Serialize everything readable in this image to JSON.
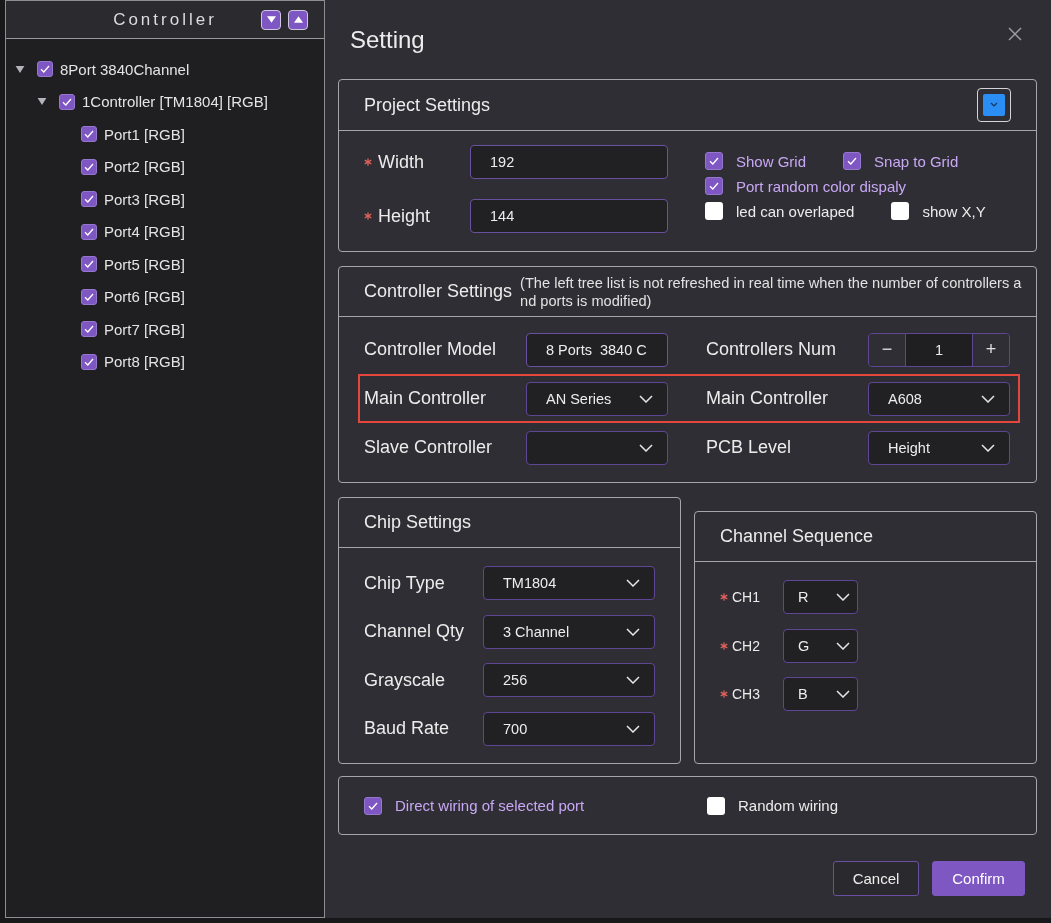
{
  "sidebar": {
    "title": "Controller",
    "tree": [
      {
        "label": "8Port 3840Channel",
        "checked": true,
        "expanded": true,
        "children": [
          {
            "label": "1Controller [TM1804] [RGB]",
            "checked": true,
            "expanded": true,
            "children": [
              {
                "label": "Port1 [RGB]",
                "checked": true
              },
              {
                "label": "Port2 [RGB]",
                "checked": true
              },
              {
                "label": "Port3 [RGB]",
                "checked": true
              },
              {
                "label": "Port4 [RGB]",
                "checked": true
              },
              {
                "label": "Port5 [RGB]",
                "checked": true
              },
              {
                "label": "Port6 [RGB]",
                "checked": true
              },
              {
                "label": "Port7 [RGB]",
                "checked": true
              },
              {
                "label": "Port8 [RGB]",
                "checked": true
              }
            ]
          }
        ]
      }
    ]
  },
  "dialog": {
    "title": "Setting",
    "project_settings": {
      "title": "Project Settings",
      "color_picker": {
        "color": "#2b8ef5"
      },
      "fields": [
        {
          "label": "Width",
          "required": true,
          "value": "192"
        },
        {
          "label": "Height",
          "required": true,
          "value": "144"
        }
      ],
      "options": [
        {
          "label": "Show Grid",
          "checked": true
        },
        {
          "label": "Snap to Grid",
          "checked": true
        },
        {
          "label": "Port random color dispaly",
          "checked": true
        },
        {
          "label": "led can overlaped",
          "checked": false
        },
        {
          "label": "show X,Y",
          "checked": false
        }
      ]
    },
    "controller_settings": {
      "title": "Controller Settings",
      "note": "(The left tree list is not refreshed in real time when the number of controllers and ports is modified)",
      "rows": [
        {
          "highlighted": false,
          "fields": [
            {
              "kind": "text",
              "label": "Controller Model",
              "value": "8 Ports  3840 C"
            },
            {
              "kind": "stepper",
              "label": "Controllers Num",
              "value": "1",
              "decrement": "−",
              "increment": "+"
            }
          ]
        },
        {
          "highlighted": true,
          "fields": [
            {
              "kind": "select",
              "label": "Main Controller",
              "value": "AN Series"
            },
            {
              "kind": "select",
              "label": "Main Controller",
              "value": "A608"
            }
          ]
        },
        {
          "highlighted": false,
          "fields": [
            {
              "kind": "select",
              "label": "Slave Controller"
            },
            {
              "kind": "select",
              "label": "PCB Level",
              "value": "Height"
            }
          ]
        }
      ]
    },
    "chip_settings": {
      "title": "Chip Settings",
      "fields": [
        {
          "label": "Chip Type",
          "value": "TM1804"
        },
        {
          "label": "Channel Qty",
          "value": "3 Channel"
        },
        {
          "label": "Grayscale",
          "value": "256"
        },
        {
          "label": "Baud Rate",
          "value": "700"
        }
      ]
    },
    "channel_sequence": {
      "title": "Channel Sequence",
      "fields": [
        {
          "label": "CH1",
          "required": true,
          "value": "R"
        },
        {
          "label": "CH2",
          "required": true,
          "value": "G"
        },
        {
          "label": "CH3",
          "required": true,
          "value": "B"
        }
      ]
    },
    "wiring": {
      "options": [
        {
          "label": "Direct wiring of selected port",
          "checked": true
        },
        {
          "label": "Random wiring",
          "checked": false
        }
      ]
    },
    "buttons": [
      {
        "label": "Cancel",
        "kind": "secondary"
      },
      {
        "label": "Confirm",
        "kind": "primary"
      }
    ]
  }
}
